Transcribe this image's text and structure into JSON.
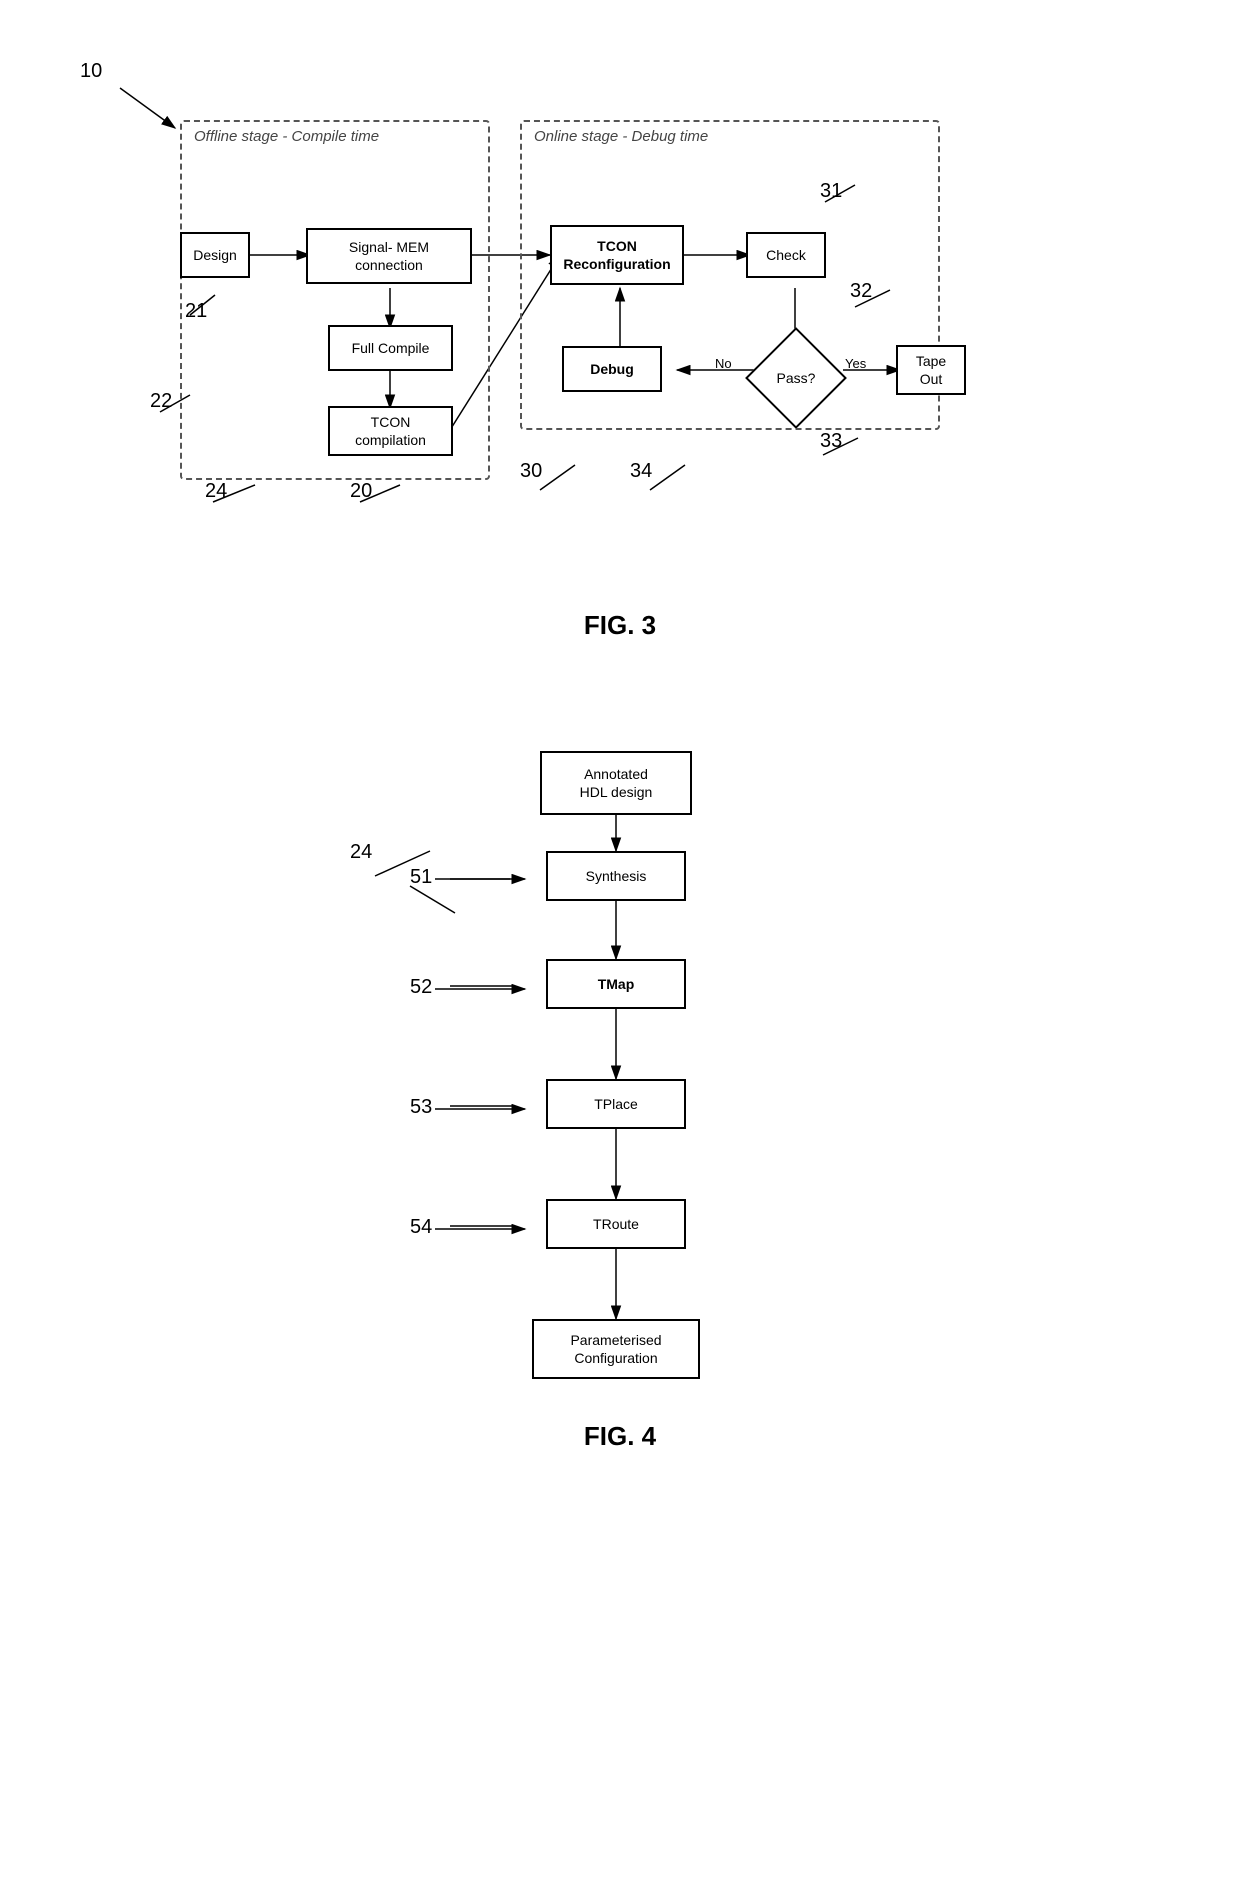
{
  "fig3": {
    "label": "FIG. 3",
    "ref_10": "10",
    "ref_20": "20",
    "ref_21": "21",
    "ref_22": "22",
    "ref_24": "24",
    "ref_30": "30",
    "ref_31": "31",
    "ref_32": "32",
    "ref_33": "33",
    "ref_34": "34",
    "offline_label": "Offline stage - Compile time",
    "online_label": "Online stage - Debug time",
    "boxes": {
      "design": "Design",
      "signal_mem": "Signal- MEM\nconnection",
      "full_compile": "Full Compile",
      "tcon_compilation": "TCON\ncompilation",
      "tcon_reconfig": "TCON\nReconfiguration",
      "check": "Check",
      "debug": "Debug",
      "pass": "Pass?",
      "tape_out": "Tape\nOut",
      "no_label": "No",
      "yes_label": "Yes"
    }
  },
  "fig4": {
    "label": "FIG. 4",
    "ref_24": "24",
    "ref_51": "51",
    "ref_52": "52",
    "ref_53": "53",
    "ref_54": "54",
    "boxes": {
      "annotated_hdl": "Annotated\nHDL design",
      "synthesis": "Synthesis",
      "tmap": "TMap",
      "tplace": "TPlace",
      "troute": "TRoute",
      "parameterised_config": "Parameterised\nConfiguration"
    }
  }
}
